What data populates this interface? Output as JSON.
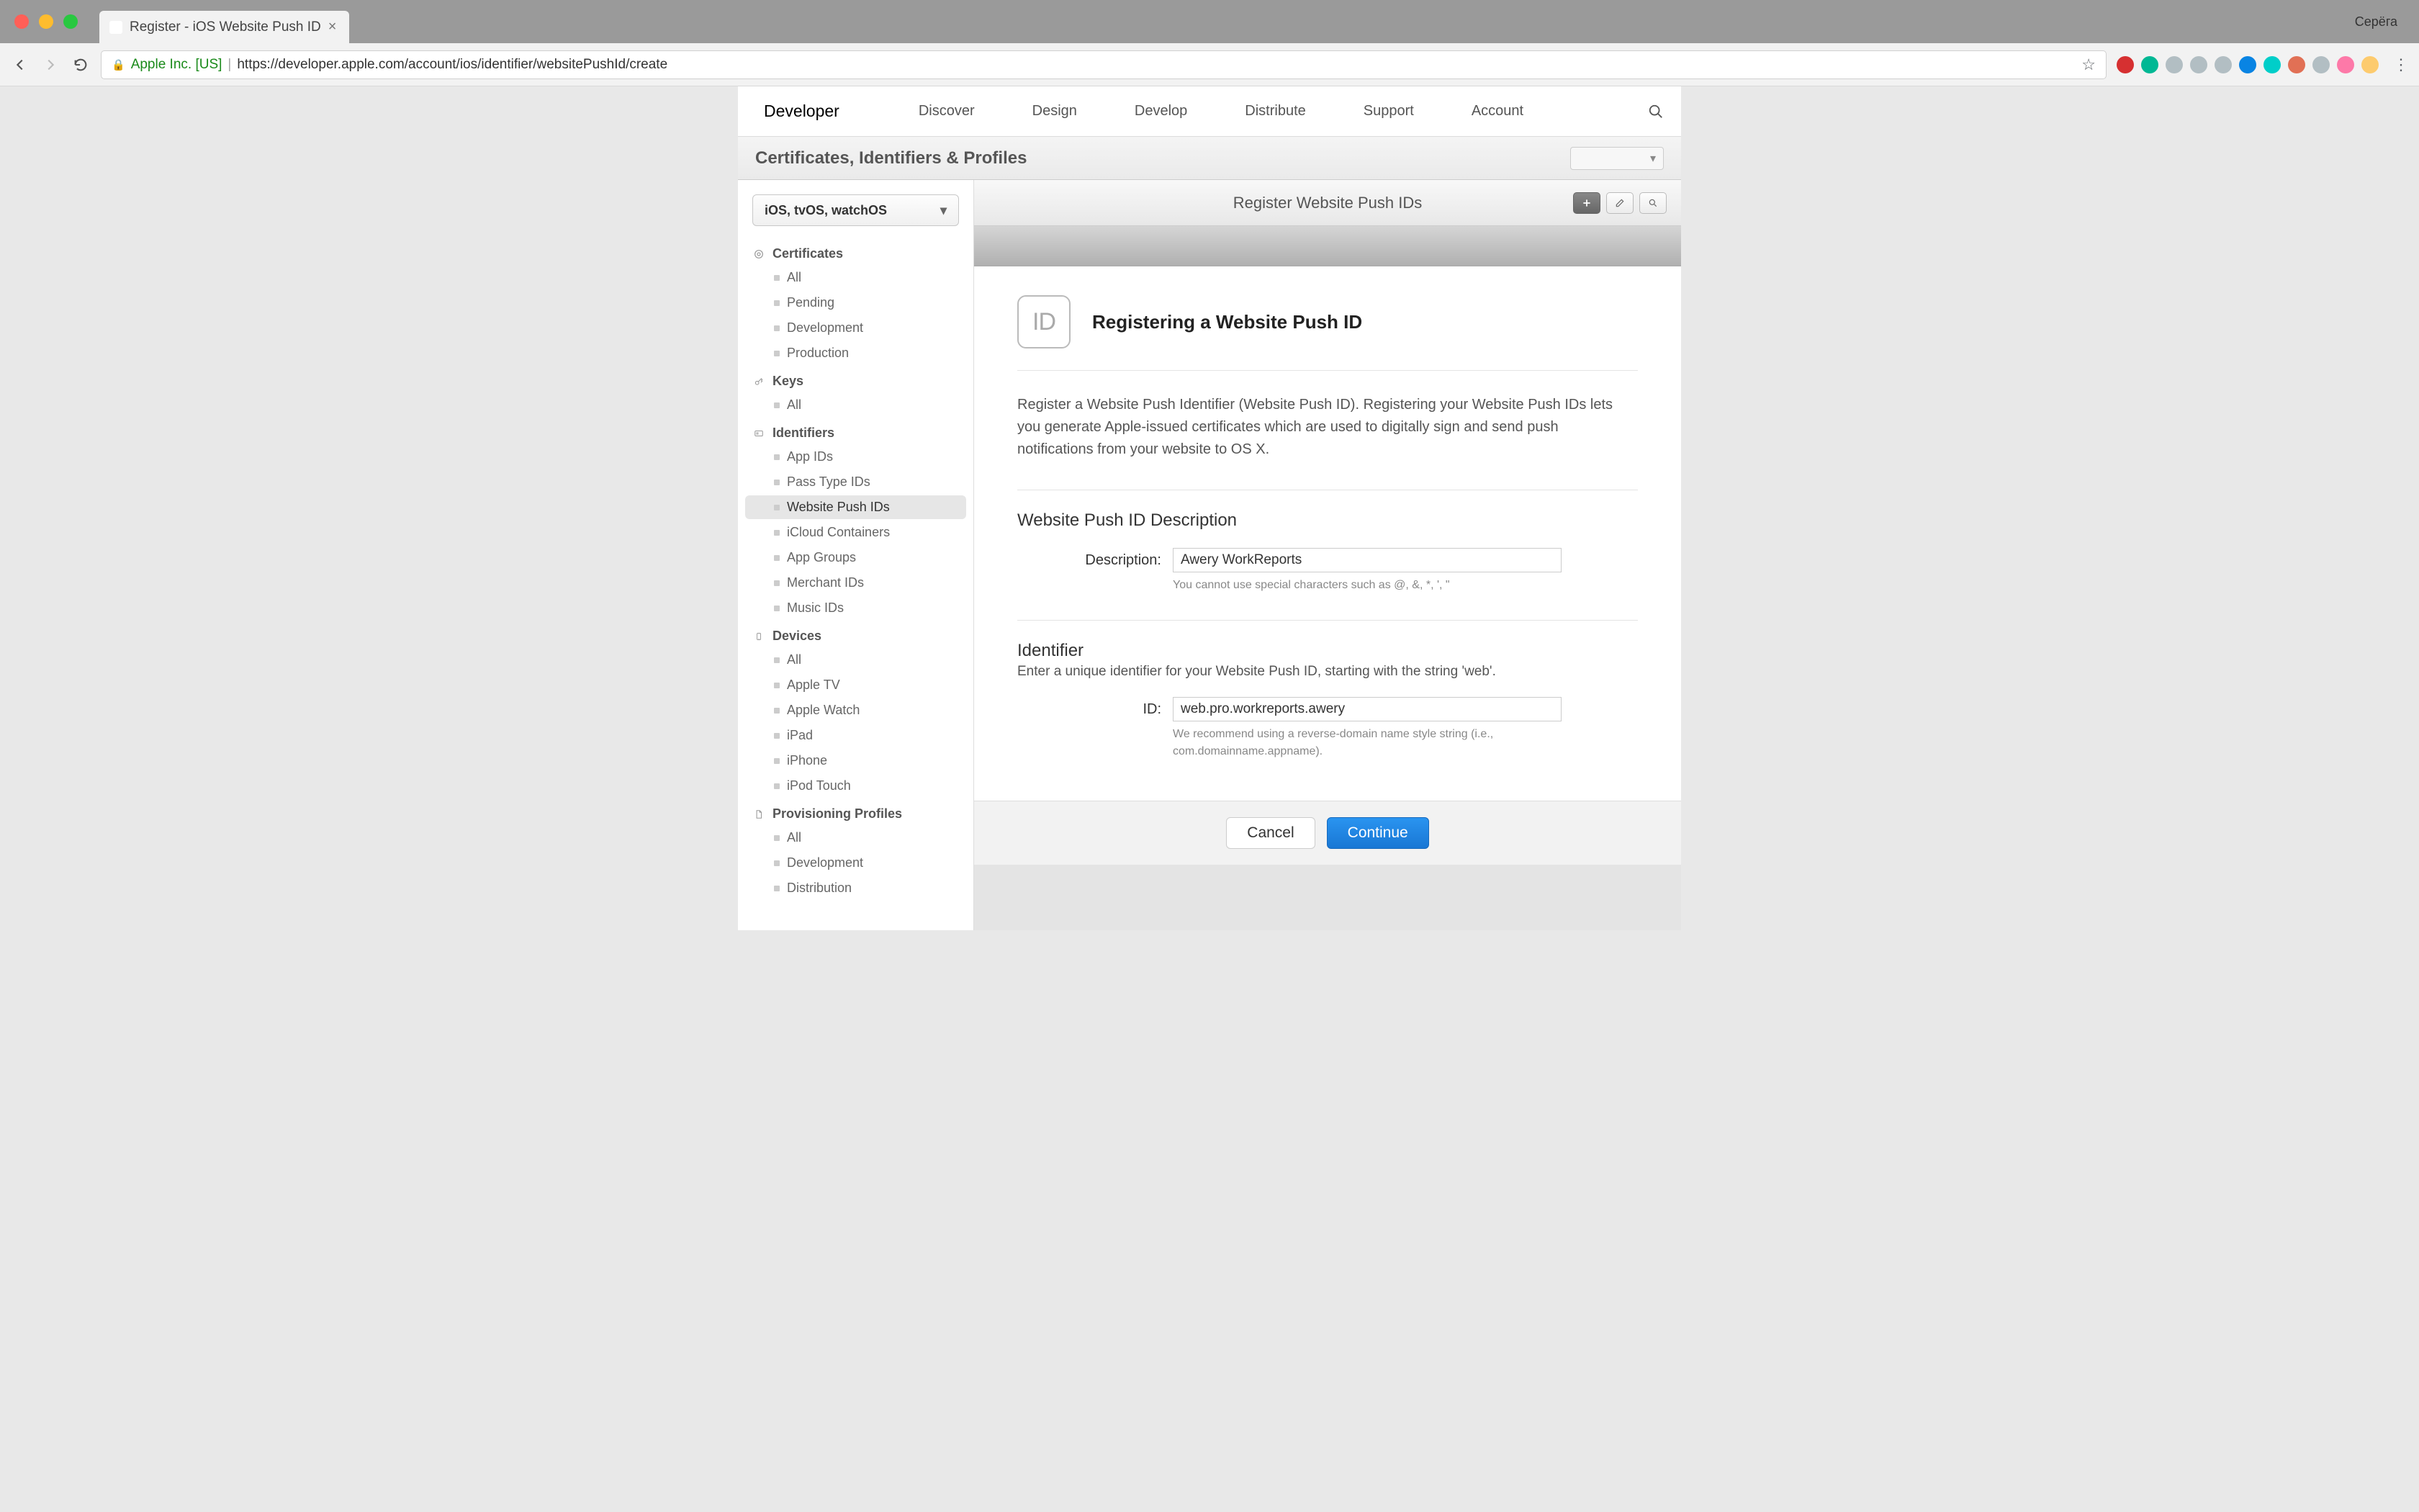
{
  "browser": {
    "tab_title": "Register - iOS Website Push ID",
    "profile": "Серёга",
    "ev_name": "Apple Inc. [US]",
    "url": "https://developer.apple.com/account/ios/identifier/websitePushId/create"
  },
  "apple_nav": {
    "brand": "Developer",
    "links": [
      "Discover",
      "Design",
      "Develop",
      "Distribute",
      "Support",
      "Account"
    ]
  },
  "section_header": "Certificates, Identifiers & Profiles",
  "platform_selector": "iOS, tvOS, watchOS",
  "sidebar": {
    "groups": [
      {
        "label": "Certificates",
        "items": [
          "All",
          "Pending",
          "Development",
          "Production"
        ]
      },
      {
        "label": "Keys",
        "items": [
          "All"
        ]
      },
      {
        "label": "Identifiers",
        "items": [
          "App IDs",
          "Pass Type IDs",
          "Website Push IDs",
          "iCloud Containers",
          "App Groups",
          "Merchant IDs",
          "Music IDs"
        ],
        "active": "Website Push IDs"
      },
      {
        "label": "Devices",
        "items": [
          "All",
          "Apple TV",
          "Apple Watch",
          "iPad",
          "iPhone",
          "iPod Touch"
        ]
      },
      {
        "label": "Provisioning Profiles",
        "items": [
          "All",
          "Development",
          "Distribution"
        ]
      }
    ]
  },
  "main": {
    "title": "Register Website Push IDs",
    "card_badge": "ID",
    "card_title": "Registering a Website Push ID",
    "intro": "Register a Website Push Identifier (Website Push ID). Registering your Website Push IDs lets you generate Apple-issued certificates which are used to digitally sign and send push notifications from your website to OS X.",
    "section_desc": {
      "title": "Website Push ID Description",
      "label": "Description:",
      "value": "Awery WorkReports",
      "hint": "You cannot use special characters such as @, &, *, ', \""
    },
    "section_id": {
      "title": "Identifier",
      "sub": "Enter a unique identifier for your Website Push ID, starting with the string 'web'.",
      "label": "ID:",
      "value": "web.pro.workreports.awery",
      "hint": "We recommend using a reverse-domain name style string (i.e., com.domainname.appname)."
    },
    "buttons": {
      "cancel": "Cancel",
      "continue": "Continue"
    }
  },
  "ext_colors": [
    "#d63031",
    "#00b894",
    "#b2bec3",
    "#b2bec3",
    "#b2bec3",
    "#0984e3",
    "#00cec9",
    "#e17055",
    "#b2bec3",
    "#fd79a8",
    "#fdcb6e"
  ]
}
